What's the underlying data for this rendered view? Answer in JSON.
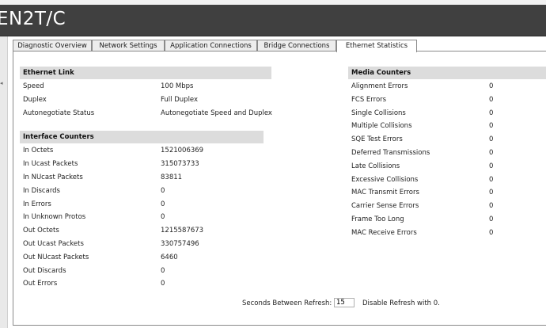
{
  "app": {
    "title": "EN2T/C"
  },
  "tabs": [
    {
      "label": "Diagnostic Overview",
      "active": false
    },
    {
      "label": "Network Settings",
      "active": false
    },
    {
      "label": "Application Connections",
      "active": false
    },
    {
      "label": "Bridge Connections",
      "active": false
    },
    {
      "label": "Ethernet Statistics",
      "active": true
    }
  ],
  "ethernet_link": {
    "header": "Ethernet Link",
    "rows": [
      {
        "label": "Speed",
        "value": "100 Mbps"
      },
      {
        "label": "Duplex",
        "value": "Full Duplex"
      },
      {
        "label": "Autonegotiate Status",
        "value": "Autonegotiate Speed and Duplex"
      }
    ]
  },
  "interface_counters": {
    "header": "Interface Counters",
    "rows": [
      {
        "label": "In Octets",
        "value": "1521006369"
      },
      {
        "label": "In Ucast Packets",
        "value": "315073733"
      },
      {
        "label": "In NUcast Packets",
        "value": "83811"
      },
      {
        "label": "In Discards",
        "value": "0"
      },
      {
        "label": "In Errors",
        "value": "0"
      },
      {
        "label": "In Unknown Protos",
        "value": "0"
      },
      {
        "label": "Out Octets",
        "value": "1215587673"
      },
      {
        "label": "Out Ucast Packets",
        "value": "330757496"
      },
      {
        "label": "Out NUcast Packets",
        "value": "6460"
      },
      {
        "label": "Out Discards",
        "value": "0"
      },
      {
        "label": "Out Errors",
        "value": "0"
      }
    ]
  },
  "media_counters": {
    "header": "Media Counters",
    "rows": [
      {
        "label": "Alignment Errors",
        "value": "0"
      },
      {
        "label": "FCS Errors",
        "value": "0"
      },
      {
        "label": "Single Collisions",
        "value": "0"
      },
      {
        "label": "Multiple Collisions",
        "value": "0"
      },
      {
        "label": "SQE Test Errors",
        "value": "0"
      },
      {
        "label": "Deferred Transmissions",
        "value": "0"
      },
      {
        "label": "Late Collisions",
        "value": "0"
      },
      {
        "label": "Excessive Collisions",
        "value": "0"
      },
      {
        "label": "MAC Transmit Errors",
        "value": "0"
      },
      {
        "label": "Carrier Sense Errors",
        "value": "0"
      },
      {
        "label": "Frame Too Long",
        "value": "0"
      },
      {
        "label": "MAC Receive Errors",
        "value": "0"
      }
    ]
  },
  "refresh": {
    "label": "Seconds Between Refresh:",
    "value": "15",
    "note": "Disable Refresh with 0."
  },
  "colors": {
    "title_bar": "#404040",
    "section_header": "#dcdcdc",
    "tab_inactive": "#ededed",
    "border": "#8a8a8a"
  }
}
